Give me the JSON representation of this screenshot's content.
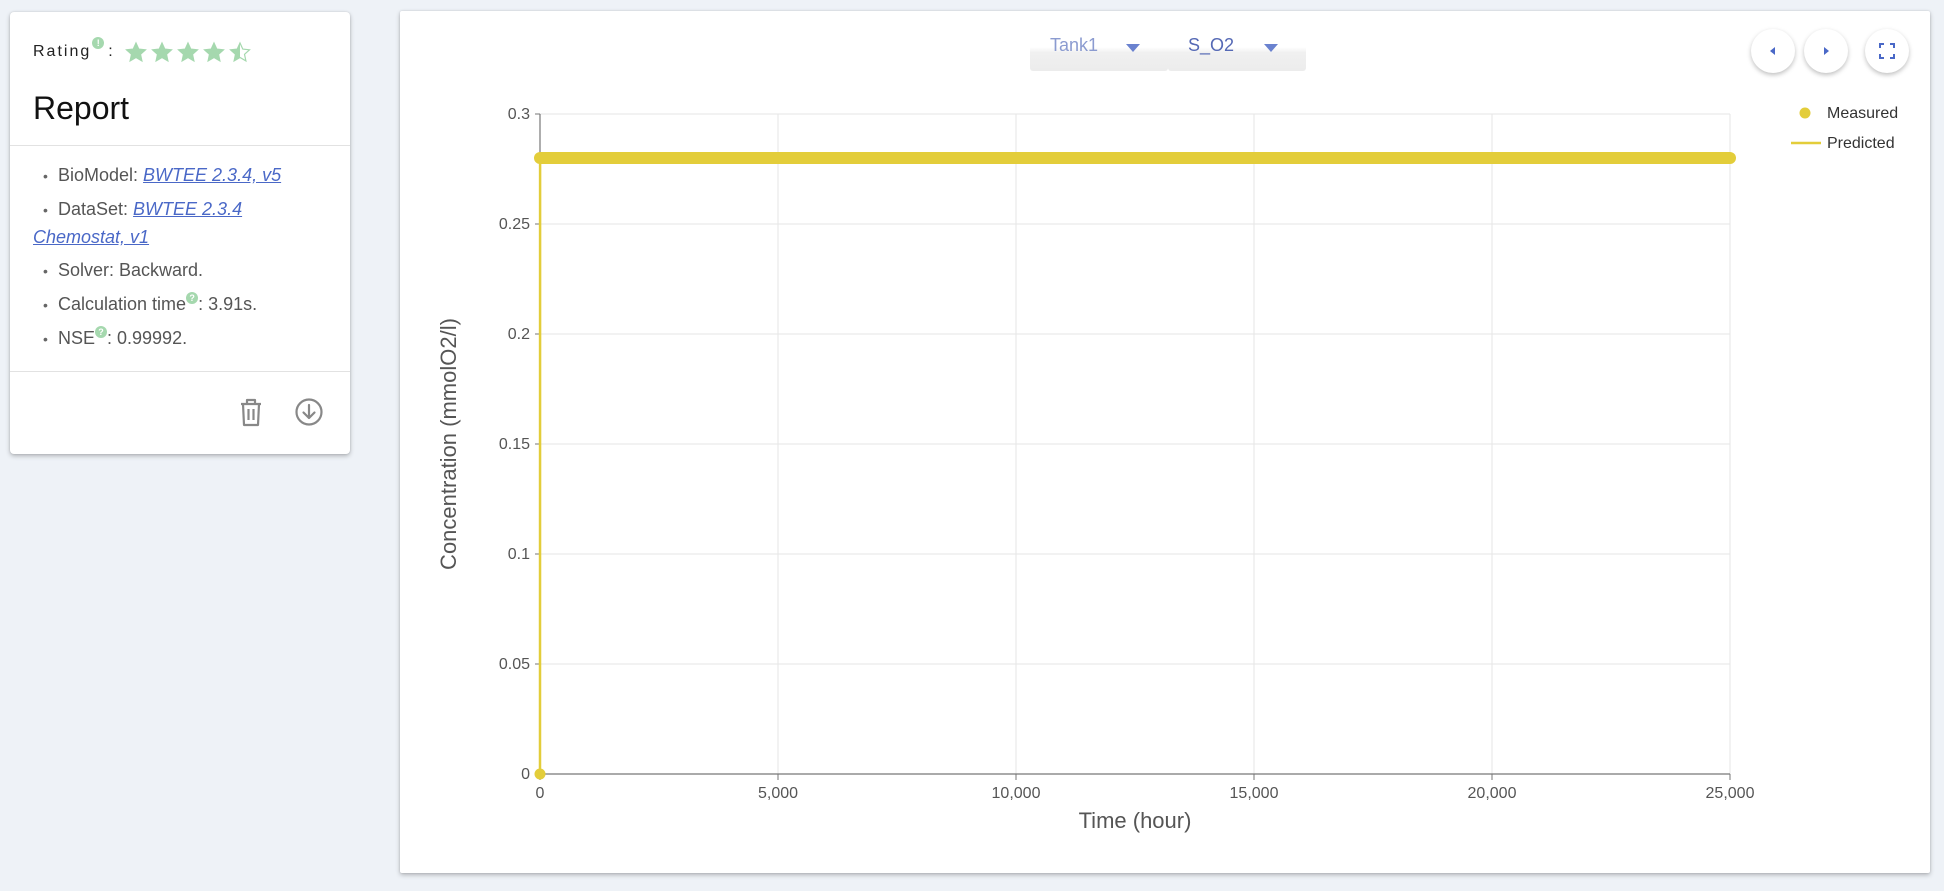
{
  "report_card": {
    "rating_label": "Rating",
    "rating_help": "!",
    "rating_colon": ":",
    "rating_value": 4.5,
    "rating_max": 5,
    "star_color": "#a5d8ae",
    "title": "Report",
    "items": [
      {
        "label": "BioModel: ",
        "link": "BWTEE 2.3.4, v5",
        "suffix": ""
      },
      {
        "label": "DataSet: ",
        "link": "BWTEE 2.3.4 Chemostat, v1",
        "suffix": ""
      },
      {
        "label": "Solver: Backward.",
        "link": "",
        "suffix": ""
      },
      {
        "label": "Calculation time",
        "help": "?",
        "suffix": ": 3.91s."
      },
      {
        "label": "NSE",
        "help": "?",
        "suffix": ": 0.99992."
      }
    ],
    "delete_icon": "trash-icon",
    "download_icon": "download-circle-icon"
  },
  "toolbar": {
    "tank_select": "Tank1",
    "variable_select": "S_O2",
    "prev_icon": "chevron-left-icon",
    "next_icon": "chevron-right-icon",
    "fullscreen_icon": "fullscreen-icon"
  },
  "colors": {
    "series": "#e3cd3a",
    "link": "#4a68c7",
    "accent": "#5569b5"
  },
  "chart_data": {
    "type": "line",
    "xlabel": "Time (hour)",
    "ylabel": "Concentration (mmolO2/l)",
    "xlim": [
      0,
      25000
    ],
    "ylim": [
      0,
      0.3
    ],
    "xticks": [
      0,
      5000,
      10000,
      15000,
      20000,
      25000
    ],
    "xtick_labels": [
      "0",
      "5,000",
      "10,000",
      "15,000",
      "20,000",
      "25,000"
    ],
    "yticks": [
      0,
      0.05,
      0.1,
      0.15,
      0.2,
      0.25,
      0.3
    ],
    "ytick_labels": [
      "0",
      "0.05",
      "0.1",
      "0.15",
      "0.2",
      "0.25",
      "0.3"
    ],
    "grid": true,
    "legend_position": "top-right",
    "series": [
      {
        "name": "Measured",
        "kind": "scatter",
        "x": [
          0,
          0,
          1000,
          2000,
          3000,
          4000,
          5000,
          6000,
          7000,
          8000,
          9000,
          10000,
          11000,
          12000,
          13000,
          14000,
          15000,
          16000,
          17000,
          18000,
          19000,
          20000,
          21000,
          22000,
          23000,
          24000,
          25000
        ],
        "y": [
          0,
          0.28,
          0.28,
          0.28,
          0.28,
          0.28,
          0.28,
          0.28,
          0.28,
          0.28,
          0.28,
          0.28,
          0.28,
          0.28,
          0.28,
          0.28,
          0.28,
          0.28,
          0.28,
          0.28,
          0.28,
          0.28,
          0.28,
          0.28,
          0.28,
          0.28,
          0.28
        ]
      },
      {
        "name": "Predicted",
        "kind": "line",
        "x": [
          0,
          2,
          25000
        ],
        "y": [
          0,
          0.28,
          0.28
        ]
      }
    ]
  }
}
